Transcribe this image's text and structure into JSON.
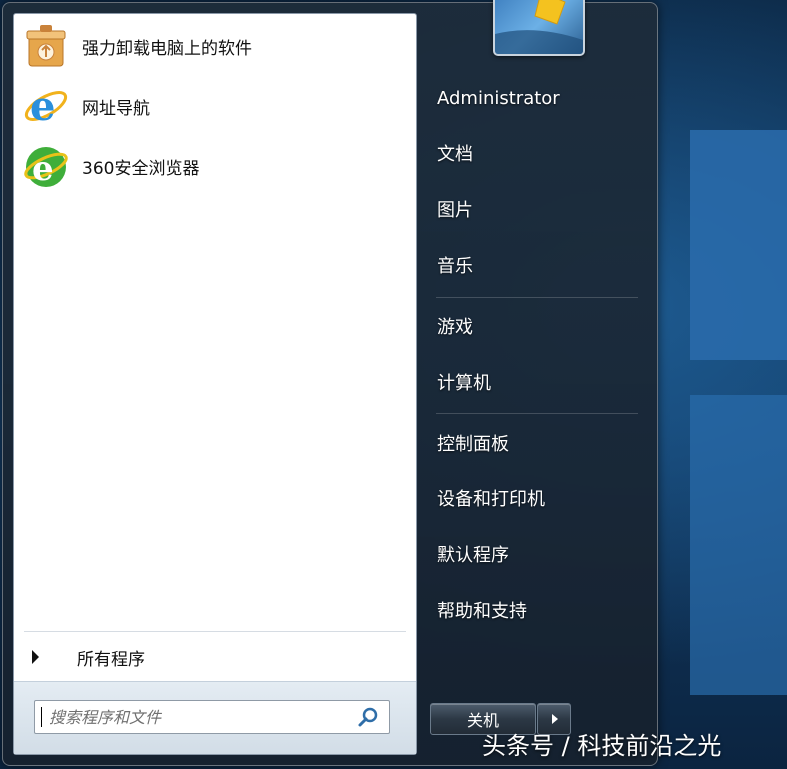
{
  "start_menu": {
    "programs": [
      {
        "label": "强力卸载电脑上的软件",
        "icon": "uninstaller-box-icon"
      },
      {
        "label": "网址导航",
        "icon": "ie-browser-icon"
      },
      {
        "label": "360安全浏览器",
        "icon": "360-browser-icon"
      }
    ],
    "all_programs_label": "所有程序",
    "search": {
      "placeholder": "搜索程序和文件",
      "value": ""
    },
    "right_items": [
      {
        "label": "Administrator"
      },
      {
        "label": "文档"
      },
      {
        "label": "图片"
      },
      {
        "label": "音乐"
      },
      {
        "label": "游戏"
      },
      {
        "label": "计算机"
      },
      {
        "label": "控制面板"
      },
      {
        "label": "设备和打印机"
      },
      {
        "label": "默认程序"
      },
      {
        "label": "帮助和支持"
      }
    ],
    "shutdown_label": "关机"
  },
  "watermark": "头条号 / 科技前沿之光",
  "colors": {
    "menu_bg": "#1e2c3a",
    "left_pane_bg": "#ffffff",
    "desktop_bg": "#123a63",
    "search_area_bg": "#dbe4ed"
  }
}
